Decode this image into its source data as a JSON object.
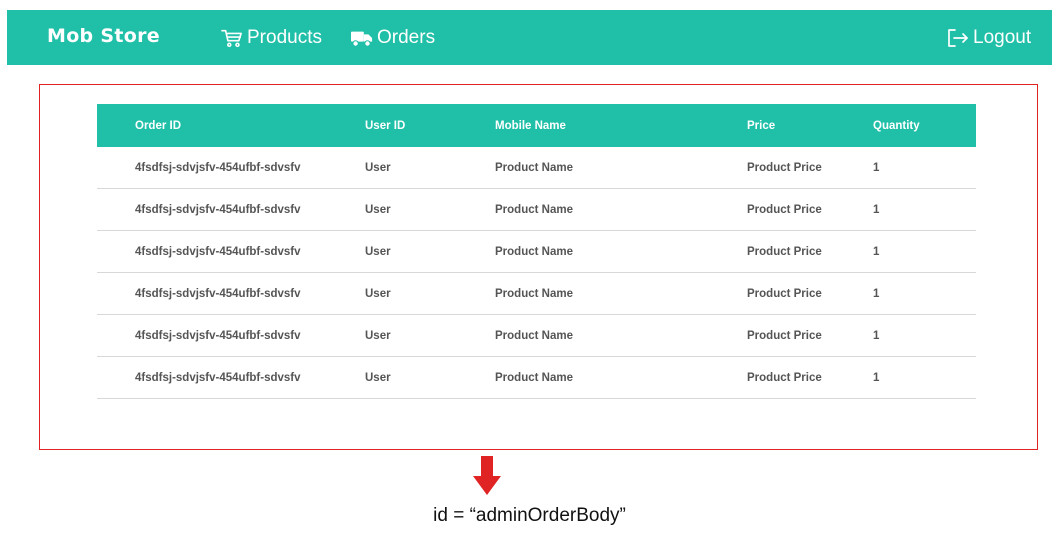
{
  "navbar": {
    "brand": "Mob Store",
    "products_label": "Products",
    "orders_label": "Orders",
    "logout_label": "Logout",
    "color": "#1fbfa8"
  },
  "table": {
    "headers": [
      "Order ID",
      "User ID",
      "Mobile Name",
      "Price",
      "Quantity"
    ],
    "rows": [
      [
        "4fsdfsj-sdvjsfv-454ufbf-sdvsfv",
        "User",
        "Product Name",
        "Product Price",
        "1"
      ],
      [
        "4fsdfsj-sdvjsfv-454ufbf-sdvsfv",
        "User",
        "Product Name",
        "Product Price",
        "1"
      ],
      [
        "4fsdfsj-sdvjsfv-454ufbf-sdvsfv",
        "User",
        "Product Name",
        "Product Price",
        "1"
      ],
      [
        "4fsdfsj-sdvjsfv-454ufbf-sdvsfv",
        "User",
        "Product Name",
        "Product Price",
        "1"
      ],
      [
        "4fsdfsj-sdvjsfv-454ufbf-sdvsfv",
        "User",
        "Product Name",
        "Product Price",
        "1"
      ],
      [
        "4fsdfsj-sdvjsfv-454ufbf-sdvsfv",
        "User",
        "Product Name",
        "Product Price",
        "1"
      ]
    ]
  },
  "annotation": {
    "caption": "id = “adminOrderBody”",
    "highlight_color": "#e02424"
  },
  "icons": [
    "cart-icon",
    "truck-icon",
    "logout-icon",
    "down-arrow-icon"
  ]
}
